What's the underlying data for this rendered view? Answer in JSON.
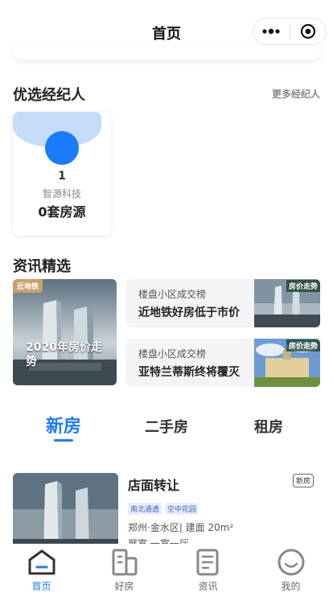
{
  "header": {
    "title": "首页",
    "more_icon": "more-dots-icon",
    "close_icon": "target-circle-icon"
  },
  "agents": {
    "section_title": "优选经纪人",
    "more_label": "更多经纪人",
    "items": [
      {
        "name": "1",
        "company": "智源科技",
        "listings": "0套房源"
      }
    ]
  },
  "news": {
    "section_title": "资讯精选",
    "featured": {
      "tag": "近地铁",
      "caption": "2020年房价走势"
    },
    "items": [
      {
        "source": "楼盘小区成交榜",
        "headline": "近地铁好房低于市价",
        "thumb_tag": "房价走势"
      },
      {
        "source": "楼盘小区成交榜",
        "headline": "亚特兰蒂斯终将覆灭",
        "thumb_tag": "房价走势"
      }
    ]
  },
  "tabs": [
    {
      "label": "新房",
      "active": true
    },
    {
      "label": "二手房",
      "active": false
    },
    {
      "label": "租房",
      "active": false
    }
  ],
  "listing": {
    "title": "店面转让",
    "type_badge": "新房",
    "tags": [
      "南北通透",
      "空中花园"
    ],
    "location": "郑州·金水区| 建面 20m²",
    "rooms": "展室 一室一厅"
  },
  "bottom_nav": [
    {
      "label": "首页",
      "icon": "home-icon",
      "active": true
    },
    {
      "label": "好房",
      "icon": "building-icon",
      "active": false
    },
    {
      "label": "资讯",
      "icon": "news-document-icon",
      "active": false
    },
    {
      "label": "我的",
      "icon": "smiley-profile-icon",
      "active": false
    }
  ],
  "colors": {
    "accent": "#1a7bfb",
    "agent_header_bg": "#c5dcfb",
    "tag_gold": "#c8a06a"
  }
}
